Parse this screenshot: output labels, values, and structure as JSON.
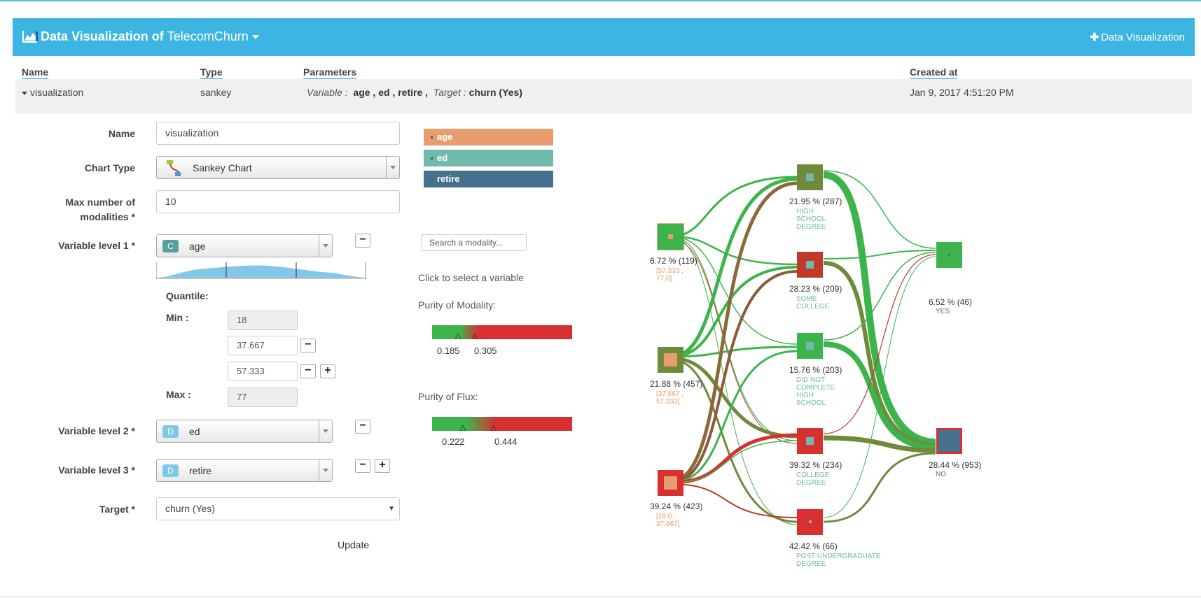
{
  "header": {
    "title_prefix": "Data Visualization of",
    "dataset": "TelecomChurn",
    "add_button": "Data Visualization"
  },
  "table": {
    "columns": [
      "Name",
      "Type",
      "Parameters",
      "Created at"
    ],
    "row": {
      "name": "visualization",
      "type": "sankey",
      "param_variable_label": "Variable :",
      "param_variables": "age ,  ed ,  retire ,",
      "param_target_label": "Target :",
      "param_target": "churn (Yes)",
      "created_at": "Jan 9, 2017 4:51:20 PM"
    }
  },
  "form": {
    "name_label": "Name",
    "name_value": "visualization",
    "chart_type_label": "Chart Type",
    "chart_type_value": "Sankey Chart",
    "max_label_1": "Max number of",
    "max_label_2": "modalities *",
    "max_value": "10",
    "var1_label": "Variable level 1 *",
    "var1_badge": "C",
    "var1_value": "age",
    "quantile_label": "Quantile:",
    "min_label": "Min :",
    "max_q_label": "Max :",
    "q_min": "18",
    "q_1": "37.667",
    "q_2": "57.333",
    "q_max": "77",
    "var2_label": "Variable level 2 *",
    "var2_badge": "D",
    "var2_value": "ed",
    "var3_label": "Variable level 3 *",
    "var3_badge": "D",
    "var3_value": "retire",
    "target_label": "Target *",
    "target_value": "churn (Yes)",
    "update_button": "Update"
  },
  "legend": [
    {
      "label": "age",
      "color": "#e89e6c"
    },
    {
      "label": "ed",
      "color": "#6fbaaa"
    },
    {
      "label": "retire",
      "color": "#467290"
    }
  ],
  "search_placeholder": "Search a modality...",
  "hint": "Click to select a variable",
  "purity_modality": {
    "label": "Purity of Modality:",
    "low": "0.185",
    "high": "0.305"
  },
  "purity_flux": {
    "label": "Purity of Flux:",
    "low": "0.222",
    "high": "0.444"
  },
  "sankey": {
    "age_nodes": [
      {
        "pct": "6.72 % (119)",
        "range": [
          "[57.333 ,",
          "77.0]"
        ]
      },
      {
        "pct": "21.88 % (457)",
        "range": [
          "[37.667 ,",
          "57.333["
        ]
      },
      {
        "pct": "39.24 % (423)",
        "range": [
          "[18.0 ,",
          "37.667["
        ]
      }
    ],
    "ed_nodes": [
      {
        "pct": "21.95 % (287)",
        "label": [
          "HIGH",
          "SCHOOL",
          "DEGREE"
        ]
      },
      {
        "pct": "28.23 % (209)",
        "label": [
          "SOME",
          "COLLEGE"
        ]
      },
      {
        "pct": "15.76 % (203)",
        "label": [
          "DID NOT",
          "COMPLETE",
          "HIGH",
          "SCHOOL"
        ]
      },
      {
        "pct": "39.32 % (234)",
        "label": [
          "COLLEGE",
          "DEGREE"
        ]
      },
      {
        "pct": "42.42 % (66)",
        "label": [
          "POST-UNDERGRADUATE",
          "DEGREE"
        ]
      }
    ],
    "retire_nodes": [
      {
        "pct": "6.52 % (46)",
        "label": [
          "YES"
        ]
      },
      {
        "pct": "28.44 % (953)",
        "label": [
          "NO"
        ]
      }
    ]
  }
}
